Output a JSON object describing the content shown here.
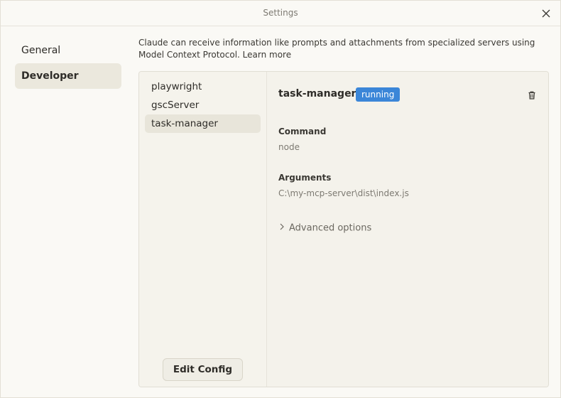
{
  "window": {
    "title": "Settings"
  },
  "nav": {
    "items": [
      {
        "label": "General",
        "active": false
      },
      {
        "label": "Developer",
        "active": true
      }
    ]
  },
  "description": {
    "text": "Claude can receive information like prompts and attachments from specialized servers using Model Context Protocol.",
    "link": "Learn more"
  },
  "servers": {
    "items": [
      {
        "label": "playwright",
        "active": false
      },
      {
        "label": "gscServer",
        "active": false
      },
      {
        "label": "task-manager",
        "active": true
      }
    ],
    "edit_config_label": "Edit Config"
  },
  "detail": {
    "name": "task-manager",
    "status": "running",
    "status_color": "#3b86d8",
    "command_label": "Command",
    "command_value": "node",
    "arguments_label": "Arguments",
    "arguments_value": "C:\\my-mcp-server\\dist\\index.js",
    "advanced_label": "Advanced options"
  },
  "icons": {
    "close": "close-icon",
    "delete": "trash-icon",
    "expand": "chevron-right-icon"
  }
}
